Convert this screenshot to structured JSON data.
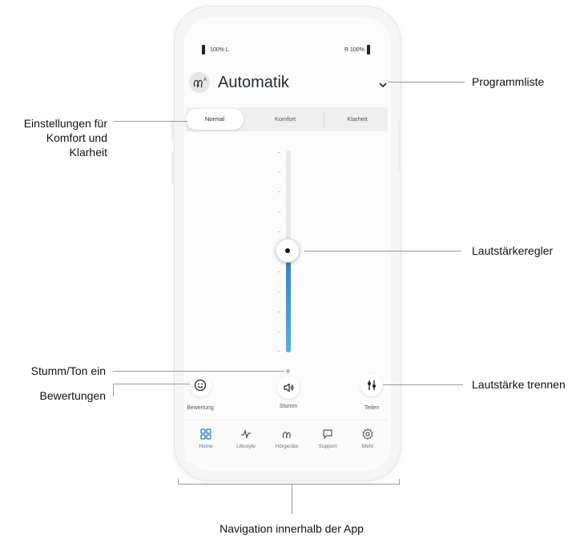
{
  "status_bar": {
    "left_battery": "100% L",
    "right_battery": "R 100%"
  },
  "header": {
    "title": "Automatik"
  },
  "tabs": [
    {
      "label": "Normal",
      "active": true
    },
    {
      "label": "Komfort",
      "active": false
    },
    {
      "label": "Klarheit",
      "active": false
    }
  ],
  "volume": {
    "level": 0.5
  },
  "actions": {
    "rating": {
      "label": "Bewertung",
      "icon": "smiley-icon"
    },
    "mute": {
      "label": "Stumm",
      "icon": "speaker-icon"
    },
    "split": {
      "label": "Teilen",
      "icon": "split-volume-icon"
    }
  },
  "nav": [
    {
      "label": "Home",
      "icon": "grid-icon",
      "active": true
    },
    {
      "label": "Lifestyle",
      "icon": "activity-icon",
      "active": false
    },
    {
      "label": "Hörgeräte",
      "icon": "hearing-aid-icon",
      "active": false
    },
    {
      "label": "Support",
      "icon": "chat-icon",
      "active": false
    },
    {
      "label": "Mehr",
      "icon": "gear-icon",
      "active": false
    }
  ],
  "callouts": {
    "program_list": "Programmliste",
    "settings_line1": "Einstellungen für",
    "settings_line2": "Komfort und",
    "settings_line3": "Klarheit",
    "volume_control": "Lautstärkeregler",
    "mute_toggle": "Stumm/Ton ein",
    "ratings": "Bewertungen",
    "split_volume": "Lautstärke trennen",
    "navigation": "Navigation innerhalb der App"
  },
  "colors": {
    "accent": "#2d7fc1",
    "slider_fill": "#3a8fd0"
  }
}
